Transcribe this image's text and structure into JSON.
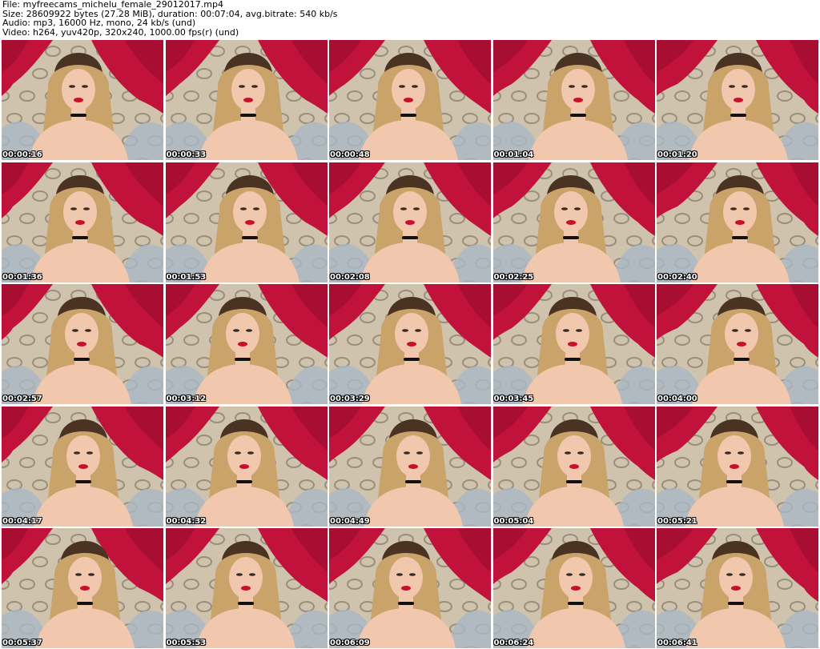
{
  "header": {
    "file_line": "File: myfreecams_michelu_female_29012017.mp4",
    "size_line": "Size: 28609922 bytes (27.28 MiB), duration: 00:07:04, avg.bitrate: 540 kb/s",
    "audio_line": "Audio: mp3, 16000 Hz, mono, 24 kb/s (und)",
    "video_line": "Video: h264, yuv420p, 320x240, 1000.00 fps(r) (und)"
  },
  "colors": {
    "curtain": "#c0123a",
    "curtain_dark": "#8e0a27",
    "wallpaper": "#cfc3ae",
    "wallpaper_pattern": "#6f6450",
    "hair": "#caa36a",
    "hair_dark": "#4a3323",
    "skin": "#f1c7ad",
    "lips": "#c8102e",
    "pillow": "#a9b8c4"
  },
  "thumbnails": [
    {
      "timestamp": "00:00:16"
    },
    {
      "timestamp": "00:00:33"
    },
    {
      "timestamp": "00:00:48"
    },
    {
      "timestamp": "00:01:04"
    },
    {
      "timestamp": "00:01:20"
    },
    {
      "timestamp": "00:01:36"
    },
    {
      "timestamp": "00:01:53"
    },
    {
      "timestamp": "00:02:08"
    },
    {
      "timestamp": "00:02:25"
    },
    {
      "timestamp": "00:02:40"
    },
    {
      "timestamp": "00:02:57"
    },
    {
      "timestamp": "00:03:12"
    },
    {
      "timestamp": "00:03:29"
    },
    {
      "timestamp": "00:03:45"
    },
    {
      "timestamp": "00:04:00"
    },
    {
      "timestamp": "00:04:17"
    },
    {
      "timestamp": "00:04:32"
    },
    {
      "timestamp": "00:04:49"
    },
    {
      "timestamp": "00:05:04"
    },
    {
      "timestamp": "00:05:21"
    },
    {
      "timestamp": "00:05:37"
    },
    {
      "timestamp": "00:05:53"
    },
    {
      "timestamp": "00:06:09"
    },
    {
      "timestamp": "00:06:24"
    },
    {
      "timestamp": "00:06:41"
    }
  ]
}
